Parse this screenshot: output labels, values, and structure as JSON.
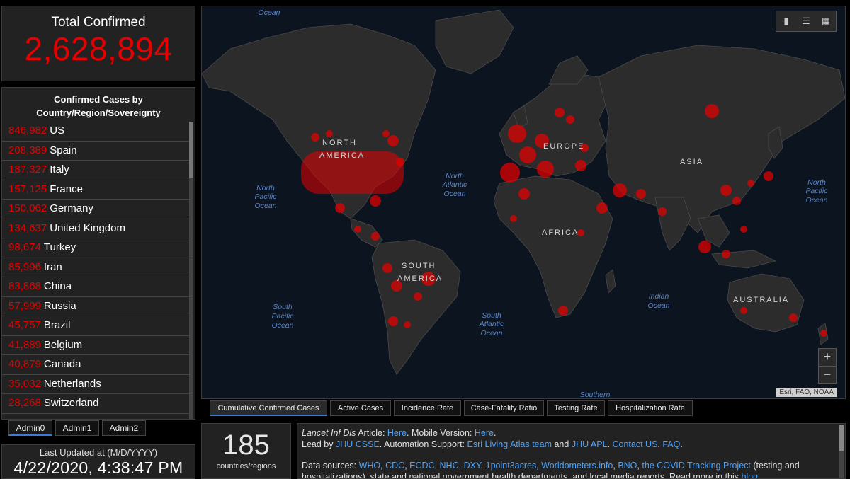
{
  "total": {
    "label": "Total Confirmed",
    "value": "2,628,894"
  },
  "country_panel": {
    "title_line1": "Confirmed Cases by",
    "title_line2": "Country/Region/Sovereignty",
    "rows": [
      {
        "count": "846,982",
        "name": "US"
      },
      {
        "count": "208,389",
        "name": "Spain"
      },
      {
        "count": "187,327",
        "name": "Italy"
      },
      {
        "count": "157,125",
        "name": "France"
      },
      {
        "count": "150,062",
        "name": "Germany"
      },
      {
        "count": "134,637",
        "name": "United Kingdom"
      },
      {
        "count": "98,674",
        "name": "Turkey"
      },
      {
        "count": "85,996",
        "name": "Iran"
      },
      {
        "count": "83,868",
        "name": "China"
      },
      {
        "count": "57,999",
        "name": "Russia"
      },
      {
        "count": "45,757",
        "name": "Brazil"
      },
      {
        "count": "41,889",
        "name": "Belgium"
      },
      {
        "count": "40,879",
        "name": "Canada"
      },
      {
        "count": "35,032",
        "name": "Netherlands"
      },
      {
        "count": "28,268",
        "name": "Switzerland"
      }
    ]
  },
  "admin_tabs": [
    "Admin0",
    "Admin1",
    "Admin2"
  ],
  "last_updated": {
    "label": "Last Updated at (M/D/YYYY)",
    "value": "4/22/2020, 4:38:47 PM"
  },
  "map": {
    "labels": {
      "north_america": [
        "NORTH",
        "AMERICA"
      ],
      "south_america": [
        "SOUTH",
        "AMERICA"
      ],
      "europe": "EUROPE",
      "asia": "ASIA",
      "africa": "AFRICA",
      "australia": "AUSTRALIA",
      "ocean_top": "Ocean",
      "north_pacific_left": [
        "North",
        "Pacific",
        "Ocean"
      ],
      "north_pacific_right": [
        "North",
        "Pacific",
        "Ocean"
      ],
      "north_atlantic": [
        "North",
        "Atlantic",
        "Ocean"
      ],
      "south_pacific": [
        "South",
        "Pacific",
        "Ocean"
      ],
      "south_atlantic": [
        "South",
        "Atlantic",
        "Ocean"
      ],
      "indian": [
        "Indian",
        "Ocean"
      ],
      "southern": "Southern"
    },
    "attribution": "Esri, FAO, NOAA",
    "zoom_in": "+",
    "zoom_out": "−",
    "accent_color": "#e60000",
    "ocean_color": "#0c1420",
    "land_color": "#2c2c2c",
    "icons": [
      "bookmark-icon",
      "list-icon",
      "qr-grid-icon"
    ]
  },
  "map_tabs": [
    "Cumulative Confirmed Cases",
    "Active Cases",
    "Incidence Rate",
    "Case-Fatality Ratio",
    "Testing Rate",
    "Hospitalization Rate"
  ],
  "countries_count": {
    "value": "185",
    "label": "countries/regions"
  },
  "info": {
    "article_journal": "Lancet Inf Dis",
    "article_word": " Article: ",
    "here1": "Here",
    "mobile": ". Mobile Version: ",
    "here2": "Here",
    "dot": ".",
    "lead_by": "Lead by ",
    "jhu_csse": "JHU CSSE",
    "automation": ". Automation Support: ",
    "esri": "Esri Living Atlas team",
    "and": " and ",
    "jhu_apl": "JHU APL",
    "dot2": ". ",
    "contact": "Contact US",
    "dot3": ". ",
    "faq": "FAQ",
    "dot4": ".",
    "sources_prefix": "Data sources: ",
    "sources": [
      "WHO",
      "CDC",
      "ECDC",
      "NHC",
      "DXY",
      "1point3acres",
      "Worldometers.info",
      "BNO",
      "the COVID Tracking Project"
    ],
    "sources_suffix": " (testing and",
    "line4": "hospitalizations), state and national government health departments, and local media reports.  Read more in this ",
    "blog": "blog"
  }
}
